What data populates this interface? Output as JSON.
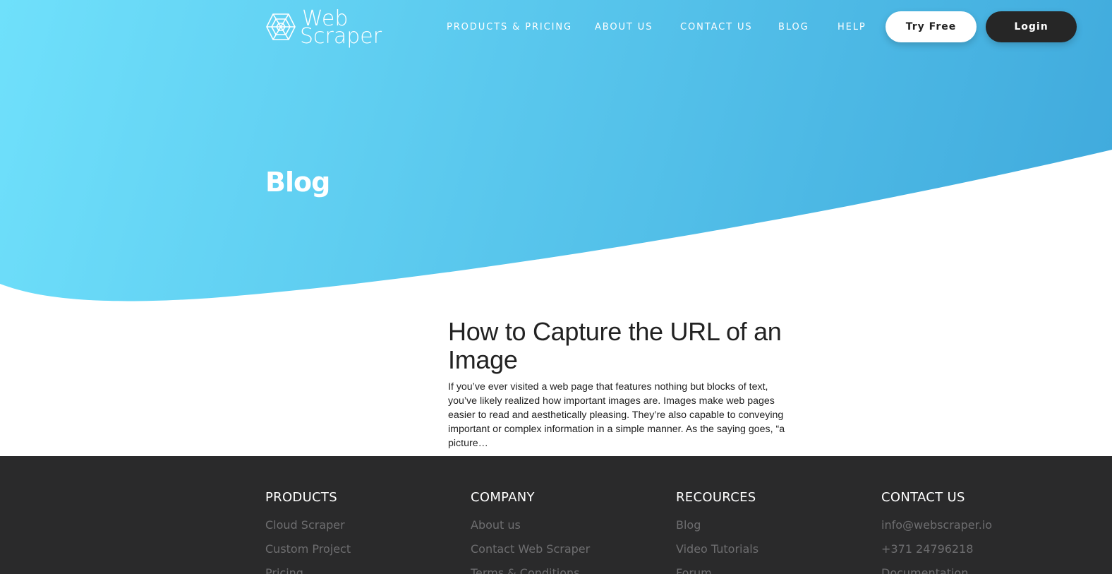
{
  "header": {
    "logo": {
      "line1": "Web",
      "line2": "Scraper"
    },
    "nav": [
      {
        "label": "PRODUCTS & PRICING"
      },
      {
        "label": "ABOUT US"
      },
      {
        "label": "CONTACT US"
      },
      {
        "label": "BLOG"
      },
      {
        "label": "HELP"
      }
    ],
    "try_free_label": "Try Free",
    "login_label": "Login"
  },
  "hero": {
    "title": "Blog"
  },
  "article": {
    "title": "How to Capture the URL of an Image",
    "excerpt": "If you’ve ever visited a web page that features nothing but blocks of text, you’ve likely realized how important images are. Images make web pages easier to read and aesthetically pleasing. They’re also capable to conveying important or complex information in a simple manner. As the saying goes, “a picture…"
  },
  "footer": {
    "columns": [
      {
        "heading": "PRODUCTS",
        "items": [
          "Cloud Scraper",
          "Custom Project",
          "Pricing"
        ]
      },
      {
        "heading": "COMPANY",
        "items": [
          "About us",
          "Contact Web Scraper",
          "Terms & Conditions"
        ]
      },
      {
        "heading": "RECOURCES",
        "items": [
          "Blog",
          "Video Tutorials",
          "Forum"
        ]
      },
      {
        "heading": "CONTACT US",
        "items": [
          "info@webscraper.io",
          "+371 24796218",
          "Documentation"
        ]
      }
    ]
  },
  "colors": {
    "hero_gradient_start": "#6fe0fb",
    "hero_gradient_end": "#41acdd",
    "footer_bg": "#2a2a2b",
    "login_bg": "#262626"
  }
}
